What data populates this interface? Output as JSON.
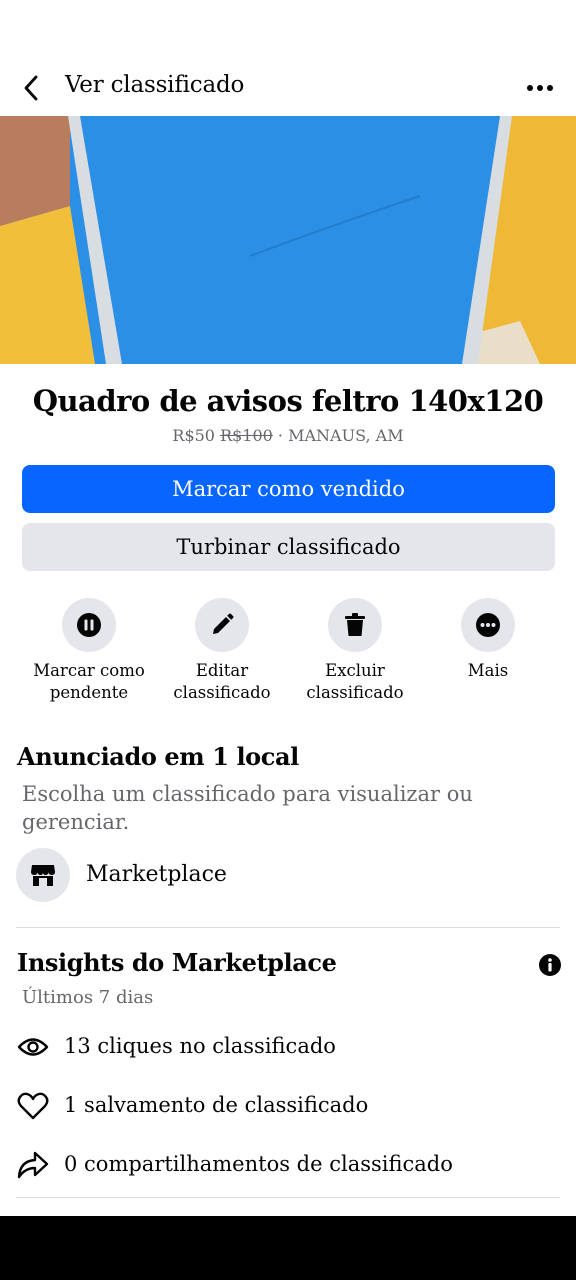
{
  "header": {
    "title": "Ver classificado",
    "back_icon": "chevron-left-icon",
    "more_icon": "more-horizontal-icon"
  },
  "photo": {
    "main_color": "#2c8fe6",
    "side_colors": [
      "#f4c13b",
      "#b87c5e"
    ]
  },
  "listing": {
    "title": "Quadro de avisos feltro 140x120",
    "price": "R$50",
    "original_price": "R$100",
    "separator": " · ",
    "location": "MANAUS, AM"
  },
  "buttons": {
    "mark_sold": "Marcar como vendido",
    "boost": "Turbinar classificado"
  },
  "actions": [
    {
      "icon": "pause-icon",
      "line1": "Marcar como",
      "line2": "pendente"
    },
    {
      "icon": "pencil-icon",
      "line1": "Editar",
      "line2": "classificado"
    },
    {
      "icon": "trash-icon",
      "line1": "Excluir",
      "line2": "classificado"
    },
    {
      "icon": "more-icon",
      "line1": "Mais",
      "line2": ""
    }
  ],
  "listed_in": {
    "title": "Anunciado em 1 local",
    "description": "Escolha um classificado para visualizar ou gerenciar.",
    "place_icon": "marketplace-shop-icon",
    "place": "Marketplace"
  },
  "insights": {
    "title": "Insights do Marketplace",
    "info_icon": "info-icon",
    "period": "Últimos 7 dias",
    "stats": [
      {
        "icon": "eye-icon",
        "text": "13 cliques no classificado"
      },
      {
        "icon": "heart-icon",
        "text": "1 salvamento de classificado"
      },
      {
        "icon": "share-icon",
        "text": "0 compartilhamentos de classificado"
      }
    ]
  },
  "colors": {
    "primary": "#0866ff",
    "secondary_bg": "#e4e6eb",
    "muted_text": "#65676b"
  }
}
